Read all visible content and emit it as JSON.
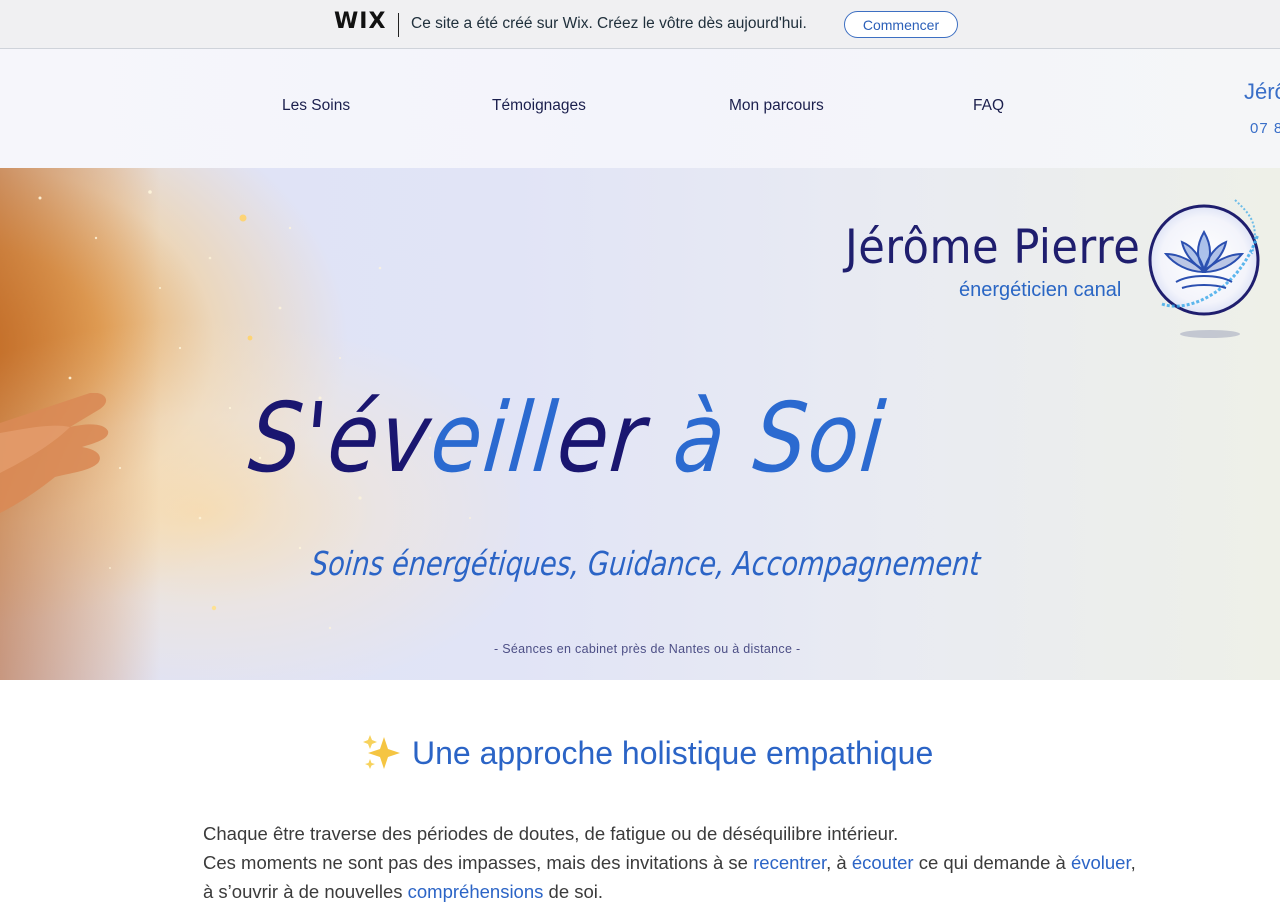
{
  "wix_banner": {
    "logo": "WIX",
    "message": "Ce site a été créé sur Wix. Créez le vôtre dès aujourd'hui.",
    "cta_label": "Commencer",
    "accent_color": "#3d6fc2"
  },
  "nav": {
    "items": [
      {
        "label": "Les Soins"
      },
      {
        "label": "Témoignages"
      },
      {
        "label": "Mon parcours"
      },
      {
        "label": "FAQ"
      }
    ],
    "right_name_partial": "Jérô",
    "right_phone_partial": "07 8"
  },
  "hero": {
    "name": "Jérôme Pierre",
    "role": "énergéticien canal",
    "title_parts": [
      "S'év",
      "eill",
      "er",
      " à Soi"
    ],
    "subtitle": "Soins énergétiques, Guidance, Accompagnement",
    "note": "- Séances en cabinet près de Nantes ou à distance -",
    "emblem_icon": "lotus-icon",
    "colors": {
      "dark_blue": "#1a1670",
      "blue": "#2b6ad0"
    }
  },
  "content": {
    "heading_icon": "sparkles-icon",
    "heading": "Une approche holistique empathique",
    "line1": "Chaque être traverse des périodes de doutes, de fatigue ou de déséquilibre intérieur.",
    "line2_a": "Ces moments ne sont pas des impasses, mais des invitations à se ",
    "line2_kw1": "recentrer",
    "line2_b": ", à ",
    "line2_kw2": "écouter",
    "line2_c": " ce qui demande à ",
    "line2_kw3": "évoluer",
    "line2_d": ",",
    "line3_a": "à s’ouvrir à de nouvelles ",
    "line3_kw1": "compréhensions",
    "line3_b": " de soi."
  }
}
